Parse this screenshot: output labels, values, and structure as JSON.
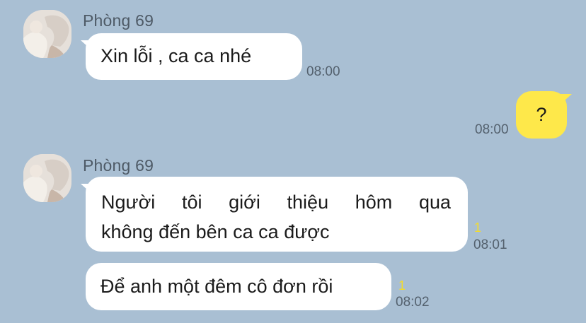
{
  "chat": {
    "messages": [
      {
        "sender": "Phòng 69",
        "text": "Xin lỗi , ca ca nhé",
        "time": "08:00"
      },
      {
        "from_me": true,
        "text": "?",
        "time": "08:00"
      },
      {
        "sender": "Phòng 69",
        "lines": [
          "Người tôi giới thiệu hôm qua",
          "không đến bên ca ca được"
        ],
        "unread": "1",
        "time": "08:01"
      },
      {
        "text": "Để anh một đêm cô đơn rồi",
        "unread": "1",
        "time": "08:02"
      }
    ]
  },
  "colors": {
    "background": "#a9bfd3",
    "incoming_bubble": "#ffffff",
    "outgoing_bubble": "#fee84a",
    "unread_badge": "#f4dc2a"
  },
  "icons": {
    "avatar": "profile-photo"
  }
}
